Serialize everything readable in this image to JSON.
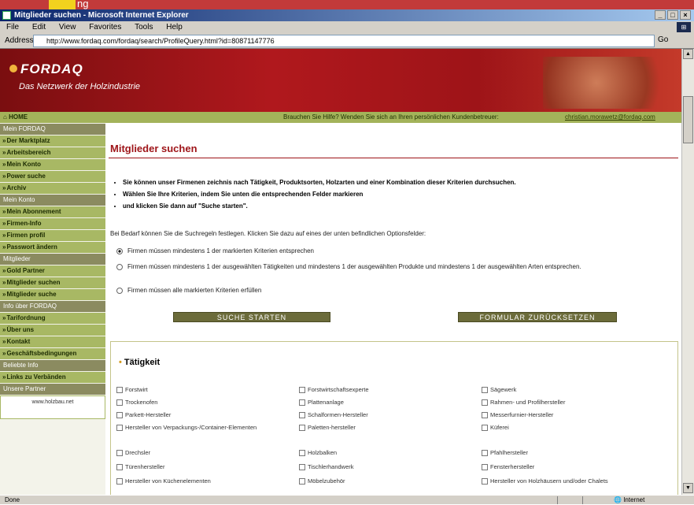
{
  "window": {
    "top_overlay_text": "ng",
    "title": "Mitglieder suchen - Microsoft Internet Explorer",
    "controls": [
      "_",
      "□",
      "×"
    ]
  },
  "menu": {
    "items": [
      "File",
      "Edit",
      "View",
      "Favorites",
      "Tools",
      "Help"
    ]
  },
  "address": {
    "label": "Address",
    "url": "http://www.fordaq.com/fordaq/search/ProfileQuery.html?id=80871147776",
    "go_label": "Go"
  },
  "banner": {
    "logo": "FORDAQ",
    "tagline": "Das Netzwerk der Holzindustrie"
  },
  "navbar": {
    "home": "HOME",
    "help_text": "Brauchen Sie Hilfe? Wenden Sie sich an Ihren persönlichen Kundenbetreuer:",
    "help_email": "christian.morawetz@fordaq.com"
  },
  "sidebar": {
    "sections": [
      {
        "head": "Mein FORDAQ",
        "items": [
          "Der Marktplatz",
          "Arbeitsbereich",
          "Mein Konto",
          "Power suche",
          "Archiv"
        ]
      },
      {
        "head": "Mein Konto",
        "items": [
          "Mein Abonnement",
          "Firmen-Info",
          "Firmen profil",
          "Passwort ändern"
        ]
      },
      {
        "head": "Mitglieder",
        "items": [
          "Gold Partner",
          "Mitglieder suchen",
          "Mitglieder suche"
        ]
      },
      {
        "head": "Info über FORDAQ",
        "items": [
          "Tarifordnung",
          "Über uns",
          "Kontakt",
          "Geschäftsbedingungen"
        ]
      },
      {
        "head": "Beliebte Info",
        "items": [
          "Links zu Verbänden"
        ]
      },
      {
        "head": "Unsere Partner",
        "items": []
      }
    ],
    "partner_text": "www.holzbau.net"
  },
  "main": {
    "title": "Mitglieder suchen",
    "bullets": [
      "Sie können unser Firmenen zeichnis nach Tätigkeit, Produktsorten, Holzarten und einer Kombination dieser Kriterien durchsuchen.",
      "Wählen Sie Ihre Kriterien, indem Sie unten die entsprechenden Felder markieren",
      "und klicken Sie dann auf \"Suche starten\"."
    ],
    "intro": "Bei Bedarf können Sie die Suchregeln festlegen. Klicken Sie dazu auf eines der unten befindlichen Optionsfelder:",
    "radios": [
      {
        "text": "Firmen müssen mindestens 1 der markierten Kriterien entsprechen",
        "checked": true
      },
      {
        "text": "Firmen müssen mindestens 1 der ausgewählten Tätigkeiten und mindestens 1 der ausgewählten Produkte und mindestens 1 der ausgewählten Arten entsprechen.",
        "checked": false
      },
      {
        "text": "Firmen müssen alle markierten Kriterien erfüllen",
        "checked": false
      }
    ],
    "search_button": "SUCHE STARTEN",
    "reset_button": "FORMULAR ZURÜCKSETZEN",
    "category_title": "Tätigkeit",
    "checkboxes": [
      [
        "Forstwirt",
        "Forstwirtschaftsexperte",
        "Sägewerk"
      ],
      [
        "Trockenofen",
        "Plattenanlage",
        "Rahmen- und Profilhersteller"
      ],
      [
        "Parkett-Hersteller",
        "Schalformen-Hersteller",
        "Messerfurnier-Hersteller"
      ],
      [
        "Hersteller von Verpackungs-/Container-Elementen",
        "Paletten-hersteller",
        "Küferei"
      ],
      [
        "Drechsler",
        "Holzbalken",
        "Pfahlhersteller"
      ],
      [
        "Türenhersteller",
        "Tischlerhandwerk",
        "Fensterhersteller"
      ],
      [
        "Hersteller von Küchenelementen",
        "Möbelzubehör",
        "Hersteller von Holzhäusern und/oder Chalets"
      ]
    ]
  },
  "status": {
    "left": "Done",
    "right": "Internet"
  }
}
